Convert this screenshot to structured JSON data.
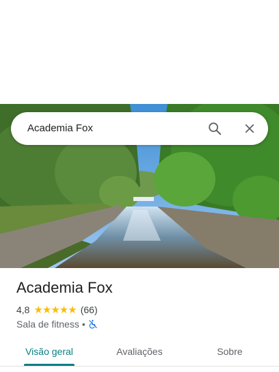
{
  "search": {
    "value": "Academia Fox"
  },
  "place": {
    "name": "Academia Fox",
    "rating": "4,8",
    "stars": "★★★★★",
    "review_count": "(66)",
    "category": "Sala de fitness",
    "separator": "•"
  },
  "tabs": [
    {
      "label": "Visão geral",
      "active": true
    },
    {
      "label": "Avaliações",
      "active": false
    },
    {
      "label": "Sobre",
      "active": false
    }
  ],
  "colors": {
    "accent": "#0b7e83",
    "star": "#fbbc04",
    "accessibility_icon": "#1a73e8"
  },
  "icons": [
    "search-icon",
    "close-icon",
    "not-wheelchair-accessible-icon"
  ]
}
